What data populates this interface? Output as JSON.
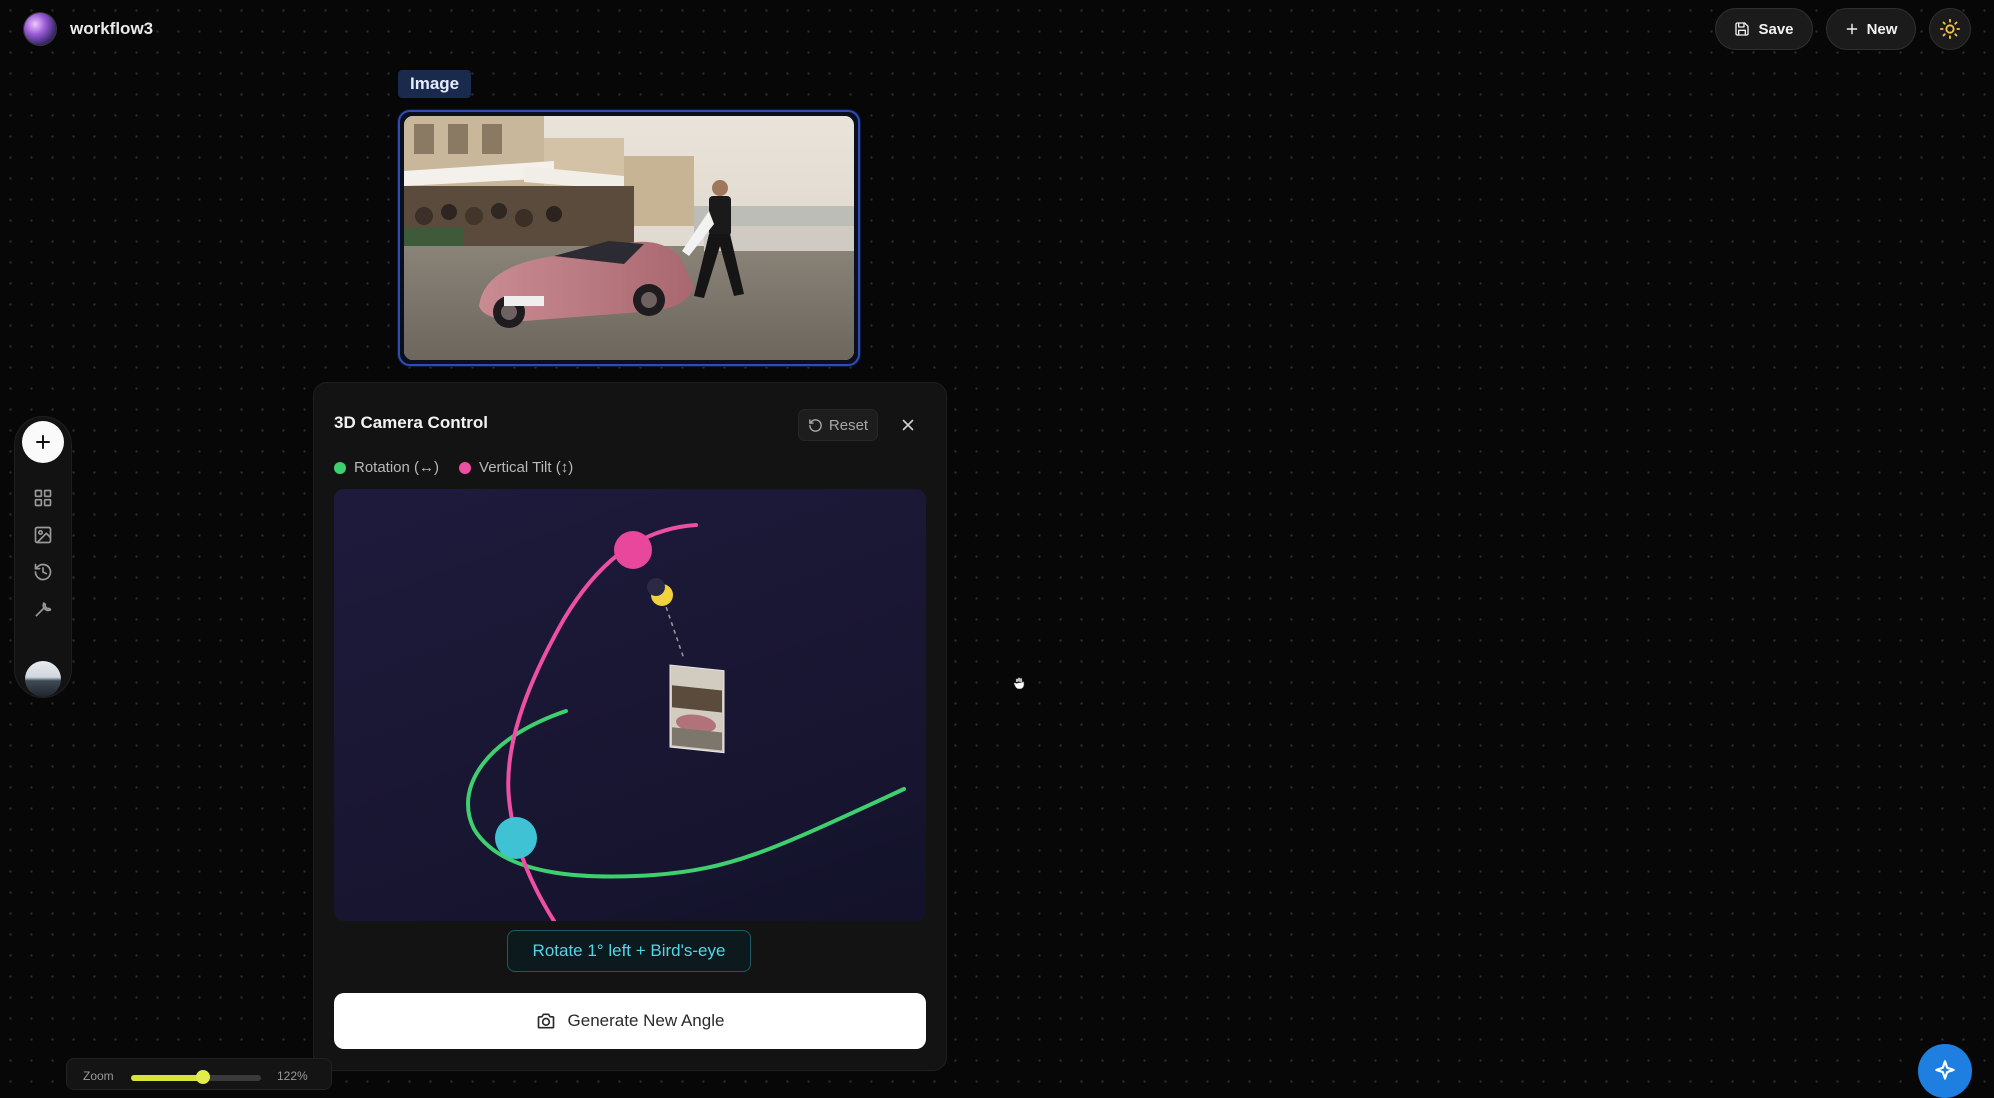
{
  "header": {
    "workflow_name": "workflow3",
    "save_label": "Save",
    "new_label": "New"
  },
  "node": {
    "label": "Image"
  },
  "camera_panel": {
    "title": "3D Camera Control",
    "reset_label": "Reset",
    "legend": [
      {
        "label": "Rotation (↔)",
        "color": "#3ecf6f"
      },
      {
        "label": "Vertical Tilt (↕)",
        "color": "#ec4fa3"
      }
    ],
    "angle_description": "Rotate 1° left + Bird's-eye",
    "generate_label": "Generate New Angle"
  },
  "zoom": {
    "label": "Zoom",
    "value_text": "122%",
    "level_fraction": 0.55
  },
  "colors": {
    "rotation_arc": "#3ecf6f",
    "tilt_arc": "#ec4fa3",
    "rotation_handle": "#3fc3d4",
    "tilt_handle": "#e8479c",
    "camera_handle": "#f0d23a",
    "node_border": "#2d4cb6",
    "accent": "#55d4e6"
  },
  "icons": {
    "save": "floppy-icon",
    "new": "plus-icon",
    "theme": "sun-icon",
    "reset": "rotate-ccw-icon",
    "close": "close-icon",
    "generate": "camera-icon"
  }
}
